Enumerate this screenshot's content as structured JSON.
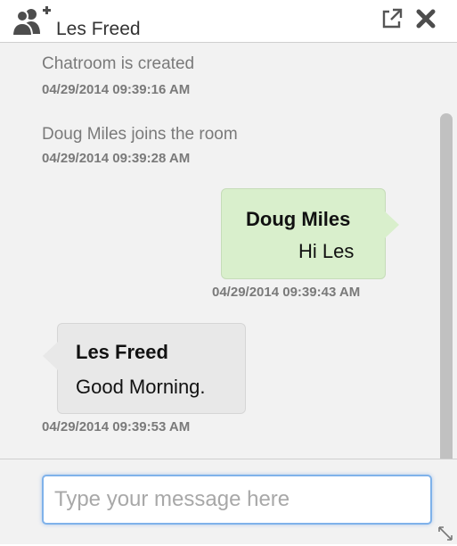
{
  "header": {
    "title": "Les Freed",
    "add_user_icon": "add-user-icon",
    "popout_icon": "popout-icon",
    "close_icon": "close-icon"
  },
  "messages": [
    {
      "type": "system",
      "text": "Chatroom is created",
      "time": "04/29/2014 09:39:16 AM"
    },
    {
      "type": "system",
      "text": "Doug Miles joins the room",
      "time": "04/29/2014 09:39:28 AM"
    },
    {
      "type": "outgoing",
      "sender": "Doug Miles",
      "text": "Hi Les",
      "time": "04/29/2014 09:39:43 AM"
    },
    {
      "type": "incoming",
      "sender": "Les Freed",
      "text": "Good Morning.",
      "time": "04/29/2014 09:39:53 AM"
    }
  ],
  "composer": {
    "placeholder": "Type your message here",
    "value": ""
  },
  "colors": {
    "outgoing_bubble": "#d9efcc",
    "incoming_bubble": "#e8e8e8",
    "input_focus": "#7fb2ea"
  }
}
